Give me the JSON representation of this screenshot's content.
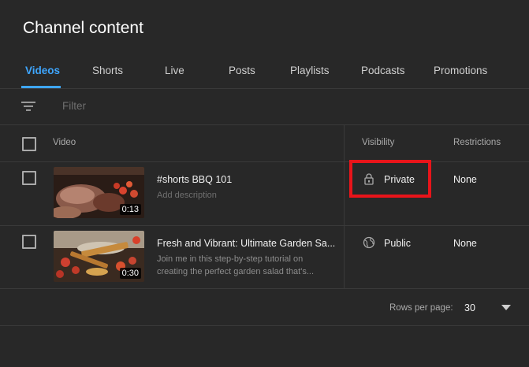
{
  "page": {
    "title": "Channel content"
  },
  "tabs": [
    {
      "label": "Videos",
      "active": true
    },
    {
      "label": "Shorts"
    },
    {
      "label": "Live"
    },
    {
      "label": "Posts"
    },
    {
      "label": "Playlists"
    },
    {
      "label": "Podcasts"
    },
    {
      "label": "Promotions"
    }
  ],
  "filter": {
    "placeholder": "Filter",
    "icon": "filter-icon"
  },
  "table": {
    "headers": {
      "video": "Video",
      "visibility": "Visibility",
      "restrictions": "Restrictions"
    },
    "rows": [
      {
        "title": "#shorts BBQ 101",
        "description": "Add description",
        "duration": "0:13",
        "visibility": "Private",
        "visibility_icon": "lock-icon",
        "restrictions": "None"
      },
      {
        "title": "Fresh and Vibrant: Ultimate Garden Sa...",
        "description_line1": "Join me in this step-by-step tutorial on",
        "description_line2": "creating the perfect garden salad that's...",
        "duration": "0:30",
        "visibility": "Public",
        "visibility_icon": "globe-icon",
        "restrictions": "None"
      }
    ]
  },
  "footer": {
    "rows_per_page_label": "Rows per page:",
    "rows_per_page_value": "30"
  },
  "colors": {
    "accent": "#3ea6ff",
    "highlight": "#e8141a",
    "background": "#282828"
  }
}
